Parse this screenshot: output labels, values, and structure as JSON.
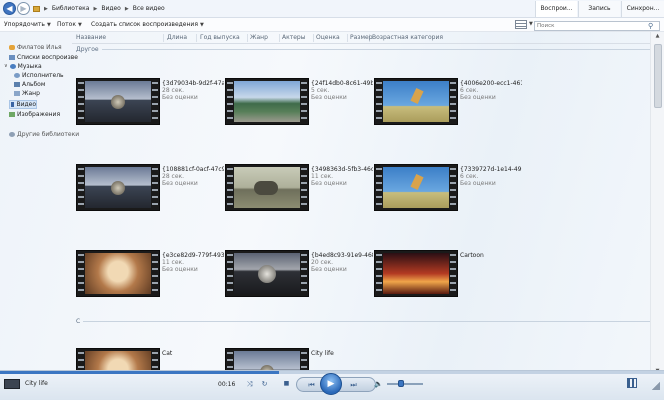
{
  "breadcrumb": [
    "Библиотека",
    "Видео",
    "Все видео"
  ],
  "tabs": [
    "Воспрои...",
    "Запись",
    "Синхрон..."
  ],
  "toolbar": {
    "organize": "Упорядочить",
    "stream": "Поток",
    "create_playlist": "Создать список воспроизведения"
  },
  "search": {
    "placeholder": "Поиск"
  },
  "sidebar": {
    "owner": "Филатов Илья",
    "playlists": "Списки воспроизве",
    "music": "Музыка",
    "artist": "Исполнитель",
    "album": "Альбом",
    "genre": "Жанр",
    "video": "Видео",
    "images": "Изображения",
    "other_libraries": "Другие библиотеки"
  },
  "columns": [
    "Название",
    "Длина",
    "Год выпуска",
    "Жанр",
    "Актеры",
    "Оценка",
    "Размер",
    "Возрастная категория"
  ],
  "groups": [
    "Другое",
    "C"
  ],
  "items": [
    {
      "title": "{3d79034b-9d2f-47a3...",
      "length": "28 сек.",
      "rating": "Без оценки",
      "pic": "city"
    },
    {
      "title": "{24f14db0-8c61-49b5...",
      "length": "5 сек.",
      "rating": "Без оценки",
      "pic": "land"
    },
    {
      "title": "{4006e200-ecc1-4618-...",
      "length": "6 сек.",
      "rating": "Без оценки",
      "pic": "jump"
    },
    {
      "title": "{108881cf-0acf-47c9-...",
      "length": "28 сек.",
      "rating": "Без оценки",
      "pic": "city"
    },
    {
      "title": "{3498363d-5fb3-46c8-...",
      "length": "11 сек.",
      "rating": "Без оценки",
      "pic": "elep"
    },
    {
      "title": "{7339727d-1e14-496b...",
      "length": "6 сек.",
      "rating": "Без оценки",
      "pic": "jump"
    },
    {
      "title": "{e3ce82d9-779f-493e-...",
      "length": "11 сек.",
      "rating": "Без оценки",
      "pic": "hands"
    },
    {
      "title": "{b4ed8c93-91e9-468c...",
      "length": "20 сек.",
      "rating": "Без оценки",
      "pic": "orb"
    },
    {
      "title": "Cartoon",
      "length": "",
      "rating": "",
      "pic": "sun"
    },
    {
      "title": "Cat",
      "length": "",
      "rating": "",
      "pic": "hands"
    },
    {
      "title": "City life",
      "length": "",
      "rating": "",
      "pic": "city"
    }
  ],
  "player": {
    "now_playing": "City life",
    "time": "00:16",
    "progress": 0.42,
    "volume": 0.4
  }
}
